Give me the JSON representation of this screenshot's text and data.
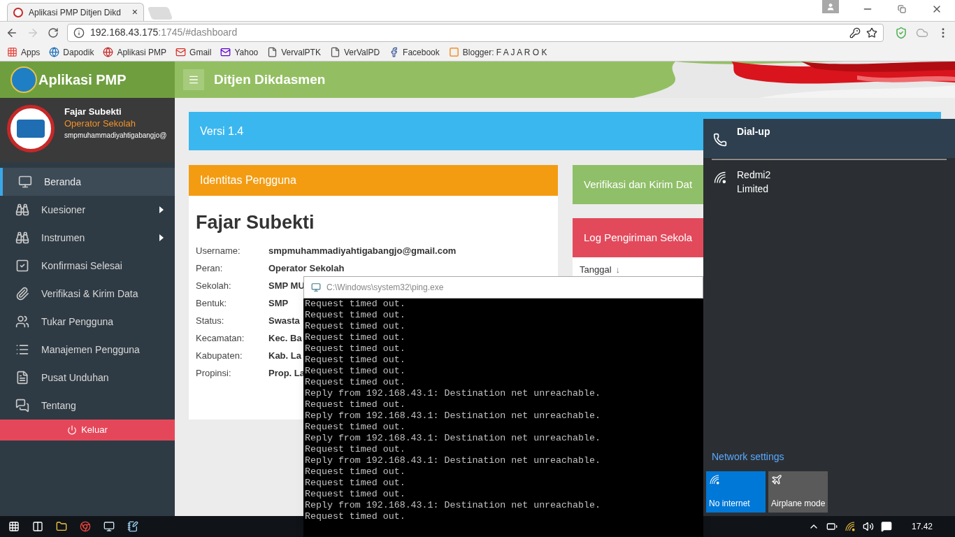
{
  "browser": {
    "tab": {
      "title": "Aplikasi PMP Ditjen Dikd",
      "close": "×"
    },
    "address": {
      "host": "192.168.43.175",
      "rest": ":1745/#dashboard"
    },
    "bookmarks": [
      {
        "label": "Apps"
      },
      {
        "label": "Dapodik"
      },
      {
        "label": "Aplikasi PMP"
      },
      {
        "label": "Gmail"
      },
      {
        "label": "Yahoo"
      },
      {
        "label": "VervalPTK"
      },
      {
        "label": "VerValPD"
      },
      {
        "label": "Facebook"
      },
      {
        "label": "Blogger: F A J A R O K"
      }
    ]
  },
  "app": {
    "brand": "Aplikasi PMP",
    "header_title": "Ditjen Dikdasmen",
    "user": {
      "name": "Fajar Subekti",
      "role": "Operator Sekolah",
      "email": "smpmuhammadiyahtigabangjo@"
    },
    "menu": [
      {
        "label": "Beranda",
        "selected": true,
        "has_submenu": false
      },
      {
        "label": "Kuesioner",
        "selected": false,
        "has_submenu": true
      },
      {
        "label": "Instrumen",
        "selected": false,
        "has_submenu": true
      },
      {
        "label": "Konfirmasi Selesai",
        "selected": false,
        "has_submenu": false
      },
      {
        "label": "Verifikasi & Kirim Data",
        "selected": false,
        "has_submenu": false
      },
      {
        "label": "Tukar Pengguna",
        "selected": false,
        "has_submenu": false
      },
      {
        "label": "Manajemen Pengguna",
        "selected": false,
        "has_submenu": false
      },
      {
        "label": "Pusat Unduhan",
        "selected": false,
        "has_submenu": false
      },
      {
        "label": "Tentang",
        "selected": false,
        "has_submenu": false
      }
    ],
    "logout": "Keluar",
    "version_card": "Versi 1.4",
    "identity": {
      "title": "Identitas Pengguna",
      "name": "Fajar Subekti",
      "rows": [
        {
          "label": "Username:",
          "value": "smpmuhammadiyahtigabangjo@gmail.com"
        },
        {
          "label": "Peran:",
          "value": "Operator Sekolah"
        },
        {
          "label": "Sekolah:",
          "value": "SMP MU"
        },
        {
          "label": "Bentuk:",
          "value": "SMP"
        },
        {
          "label": "Status:",
          "value": "Swasta"
        },
        {
          "label": "Kecamatan:",
          "value": "Kec. Ba"
        },
        {
          "label": "Kabupaten:",
          "value": "Kab. La"
        },
        {
          "label": "Propinsi:",
          "value": "Prop. La"
        }
      ]
    },
    "verify_card": "Verifikasi dan Kirim Dat",
    "log_card": {
      "title": "Log Pengiriman Sekola",
      "column": "Tanggal",
      "sort_arrow": "↓"
    }
  },
  "console": {
    "title": "C:\\Windows\\system32\\ping.exe",
    "lines": [
      "Request timed out.",
      "Request timed out.",
      "Request timed out.",
      "Request timed out.",
      "Request timed out.",
      "Request timed out.",
      "Request timed out.",
      "Request timed out.",
      "Reply from 192.168.43.1: Destination net unreachable.",
      "Request timed out.",
      "Reply from 192.168.43.1: Destination net unreachable.",
      "Request timed out.",
      "Reply from 192.168.43.1: Destination net unreachable.",
      "Request timed out.",
      "Reply from 192.168.43.1: Destination net unreachable.",
      "Request timed out.",
      "Request timed out.",
      "Request timed out.",
      "Reply from 192.168.43.1: Destination net unreachable.",
      "Request timed out."
    ]
  },
  "network_flyout": {
    "networks": [
      {
        "kind": "dialup",
        "name": "Dial-up"
      },
      {
        "kind": "wifi",
        "name": "Redmi2",
        "status": "Limited"
      }
    ],
    "settings_link": "Network settings",
    "tiles": [
      {
        "kind": "wifi",
        "label": "No internet",
        "on": true
      },
      {
        "kind": "airplane",
        "label": "Airplane mode",
        "on": false
      }
    ]
  },
  "taskbar": {
    "time": "17.42"
  }
}
